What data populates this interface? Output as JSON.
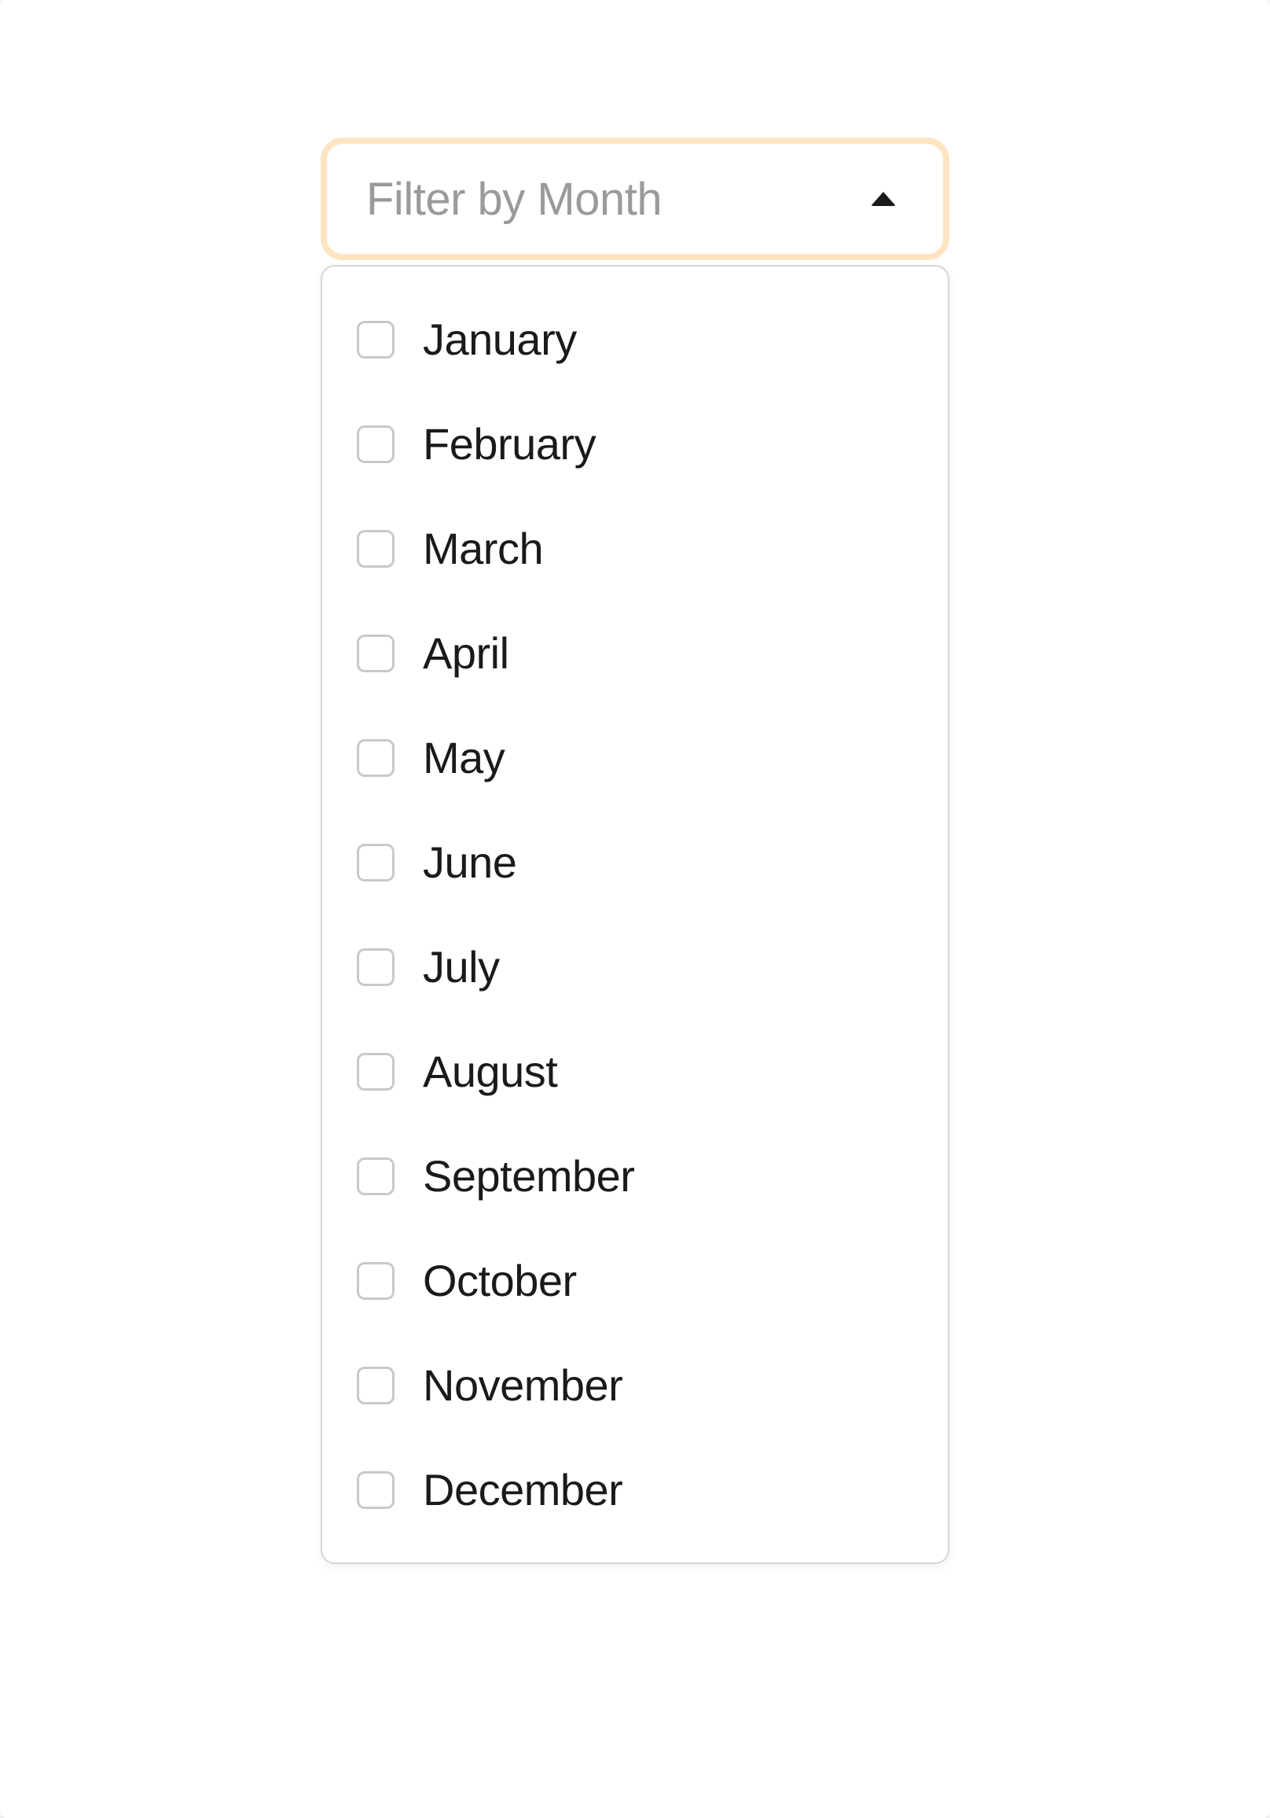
{
  "filter": {
    "label": "Filter by Month",
    "open": true,
    "options": [
      {
        "label": "January",
        "checked": false
      },
      {
        "label": "February",
        "checked": false
      },
      {
        "label": "March",
        "checked": false
      },
      {
        "label": "April",
        "checked": false
      },
      {
        "label": "May",
        "checked": false
      },
      {
        "label": "June",
        "checked": false
      },
      {
        "label": "July",
        "checked": false
      },
      {
        "label": "August",
        "checked": false
      },
      {
        "label": "September",
        "checked": false
      },
      {
        "label": "October",
        "checked": false
      },
      {
        "label": "November",
        "checked": false
      },
      {
        "label": "December",
        "checked": false
      }
    ]
  }
}
